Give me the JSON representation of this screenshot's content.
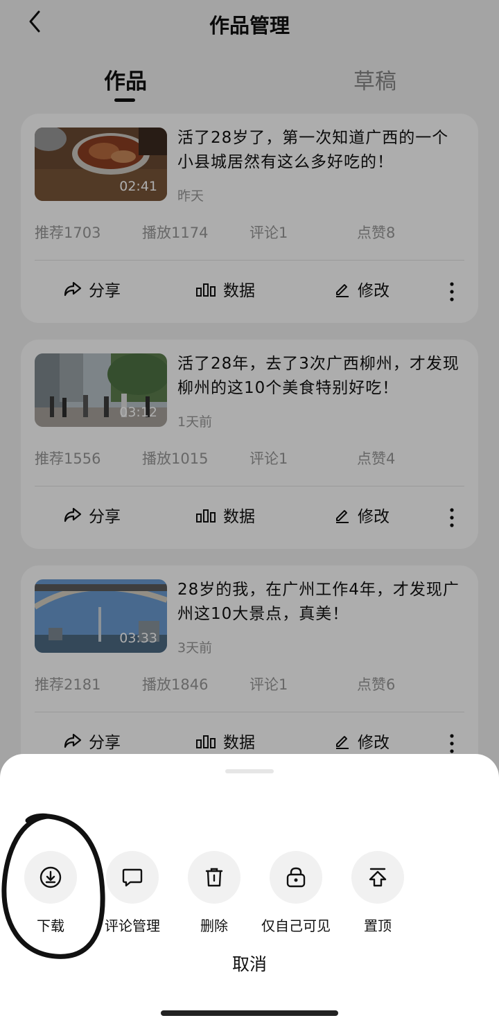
{
  "header": {
    "title": "作品管理"
  },
  "tabs": [
    {
      "label": "作品"
    },
    {
      "label": "草稿"
    }
  ],
  "videos": [
    {
      "title": "活了28岁了，第一次知道广西的一个小县城居然有这么多好吃的！",
      "duration": "02:41",
      "date": "昨天",
      "stats": {
        "recommend": "推荐1703",
        "play": "播放1174",
        "comment": "评论1",
        "like": "点赞8"
      }
    },
    {
      "title": "活了28年，去了3次广西柳州，才发现柳州的这10个美食特别好吃！",
      "duration": "03:12",
      "date": "1天前",
      "stats": {
        "recommend": "推荐1556",
        "play": "播放1015",
        "comment": "评论1",
        "like": "点赞4"
      }
    },
    {
      "title": "28岁的我，在广州工作4年，才发现广州这10大景点，真美！",
      "duration": "03:33",
      "date": "3天前",
      "stats": {
        "recommend": "推荐2181",
        "play": "播放1846",
        "comment": "评论1",
        "like": "点赞6"
      }
    }
  ],
  "actions": {
    "share": "分享",
    "data": "数据",
    "edit": "修改"
  },
  "sheet": {
    "options": [
      {
        "label": "下载",
        "icon": "download-icon"
      },
      {
        "label": "评论管理",
        "icon": "comment-icon"
      },
      {
        "label": "删除",
        "icon": "trash-icon"
      },
      {
        "label": "仅自己可见",
        "icon": "lock-icon"
      },
      {
        "label": "置顶",
        "icon": "pin-top-icon"
      }
    ],
    "cancel": "取消"
  }
}
